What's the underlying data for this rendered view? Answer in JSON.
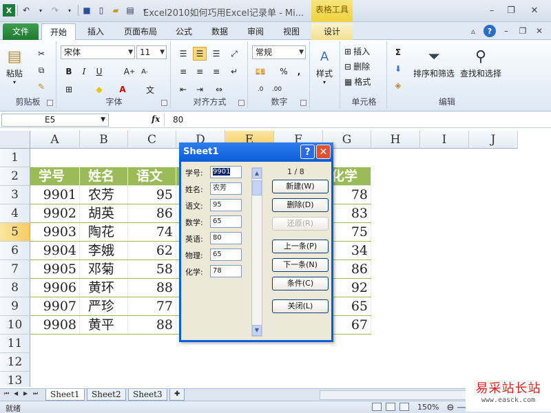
{
  "window": {
    "title": "Excel2010如何巧用Excel记录单 - Mi...",
    "context_tab": "表格工具"
  },
  "tabs": [
    "文件",
    "开始",
    "插入",
    "页面布局",
    "公式",
    "数据",
    "审阅",
    "视图",
    "设计"
  ],
  "ribbon": {
    "clipboard": {
      "paste": "粘贴",
      "label": "剪贴板"
    },
    "font": {
      "name": "宋体",
      "size": "11",
      "label": "字体"
    },
    "alignment": {
      "label": "对齐方式"
    },
    "number": {
      "format": "常规",
      "label": "数字"
    },
    "styles": {
      "label": "样式"
    },
    "cells": {
      "insert": "插入",
      "delete": "删除",
      "format": "格式",
      "label": "单元格"
    },
    "editing": {
      "sort_filter": "排序和筛选",
      "find_select": "查找和选择",
      "label": "编辑"
    }
  },
  "formula_bar": {
    "name_box": "E5",
    "fx": "fx",
    "value": "80"
  },
  "columns": [
    "A",
    "B",
    "C",
    "D",
    "E",
    "F",
    "G",
    "H",
    "I",
    "J"
  ],
  "rows": [
    "1",
    "2",
    "3",
    "4",
    "5",
    "6",
    "7",
    "8",
    "9",
    "10",
    "11",
    "12",
    "13"
  ],
  "selected_cell": {
    "column": "E",
    "row": "5"
  },
  "table": {
    "headers": {
      "A": "学号",
      "B": "姓名",
      "C": "语文",
      "G": "化学"
    },
    "rows": [
      {
        "A": "9901",
        "B": "农芳",
        "C": "95",
        "G": "78"
      },
      {
        "A": "9902",
        "B": "胡英",
        "C": "86",
        "G": "83"
      },
      {
        "A": "9903",
        "B": "陶花",
        "C": "74",
        "G": "75"
      },
      {
        "A": "9904",
        "B": "李娥",
        "C": "62",
        "G": "34"
      },
      {
        "A": "9905",
        "B": "邓菊",
        "C": "58",
        "G": "86"
      },
      {
        "A": "9906",
        "B": "黄环",
        "C": "88",
        "G": "92"
      },
      {
        "A": "9907",
        "B": "严珍",
        "C": "77",
        "G": "65"
      },
      {
        "A": "9908",
        "B": "黄平",
        "C": "88",
        "G": "67"
      }
    ],
    "header_color": "#9bbb59"
  },
  "dialog": {
    "title": "Sheet1",
    "fields": [
      {
        "label": "学号:",
        "value": "9901"
      },
      {
        "label": "姓名:",
        "value": "农芳"
      },
      {
        "label": "语文:",
        "value": "95"
      },
      {
        "label": "数学:",
        "value": "65"
      },
      {
        "label": "英语:",
        "value": "80"
      },
      {
        "label": "物理:",
        "value": "65"
      },
      {
        "label": "化学:",
        "value": "78"
      }
    ],
    "record_count": "1 / 8",
    "buttons": {
      "new": "新建(W)",
      "delete": "删除(D)",
      "restore": "还原(R)",
      "prev": "上一条(P)",
      "next": "下一条(N)",
      "criteria": "条件(C)",
      "close": "关闭(L)"
    }
  },
  "sheets": [
    "Sheet1",
    "Sheet2",
    "Sheet3"
  ],
  "status": {
    "ready": "就绪",
    "zoom": "150%"
  },
  "watermark": {
    "line1": "易采站长站",
    "line2": "www.easck.com"
  }
}
